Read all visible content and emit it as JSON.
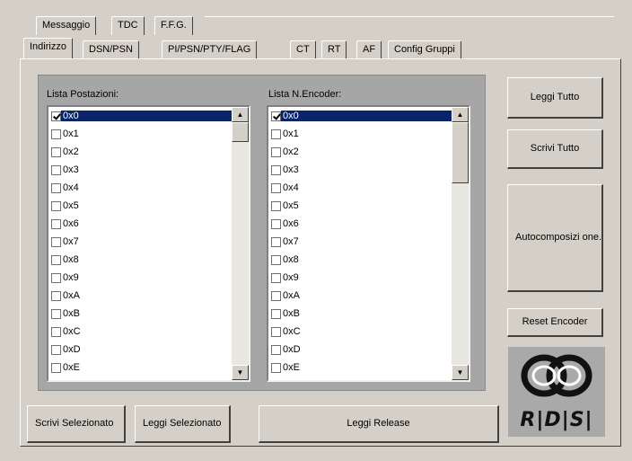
{
  "top_tabs": [
    "Messaggio",
    "TDC",
    "F.F.G."
  ],
  "sub_tabs": [
    "Indirizzo",
    "DSN/PSN",
    "PI/PSN/PTY/FLAG",
    "CT",
    "RT",
    "AF",
    "Config Gruppi"
  ],
  "selected_sub_tab": "Indirizzo",
  "lists": {
    "postazioni": {
      "label": "Lista Postazioni:",
      "items": [
        {
          "label": "0x0",
          "checked": true,
          "selected": true
        },
        {
          "label": "0x1",
          "checked": false,
          "selected": false
        },
        {
          "label": "0x2",
          "checked": false,
          "selected": false
        },
        {
          "label": "0x3",
          "checked": false,
          "selected": false
        },
        {
          "label": "0x4",
          "checked": false,
          "selected": false
        },
        {
          "label": "0x5",
          "checked": false,
          "selected": false
        },
        {
          "label": "0x6",
          "checked": false,
          "selected": false
        },
        {
          "label": "0x7",
          "checked": false,
          "selected": false
        },
        {
          "label": "0x8",
          "checked": false,
          "selected": false
        },
        {
          "label": "0x9",
          "checked": false,
          "selected": false
        },
        {
          "label": "0xA",
          "checked": false,
          "selected": false
        },
        {
          "label": "0xB",
          "checked": false,
          "selected": false
        },
        {
          "label": "0xC",
          "checked": false,
          "selected": false
        },
        {
          "label": "0xD",
          "checked": false,
          "selected": false
        },
        {
          "label": "0xE",
          "checked": false,
          "selected": false
        }
      ]
    },
    "encoder": {
      "label": "Lista N.Encoder:",
      "items": [
        {
          "label": "0x0",
          "checked": true,
          "selected": true
        },
        {
          "label": "0x1",
          "checked": false,
          "selected": false
        },
        {
          "label": "0x2",
          "checked": false,
          "selected": false
        },
        {
          "label": "0x3",
          "checked": false,
          "selected": false
        },
        {
          "label": "0x4",
          "checked": false,
          "selected": false
        },
        {
          "label": "0x5",
          "checked": false,
          "selected": false
        },
        {
          "label": "0x6",
          "checked": false,
          "selected": false
        },
        {
          "label": "0x7",
          "checked": false,
          "selected": false
        },
        {
          "label": "0x8",
          "checked": false,
          "selected": false
        },
        {
          "label": "0x9",
          "checked": false,
          "selected": false
        },
        {
          "label": "0xA",
          "checked": false,
          "selected": false
        },
        {
          "label": "0xB",
          "checked": false,
          "selected": false
        },
        {
          "label": "0xC",
          "checked": false,
          "selected": false
        },
        {
          "label": "0xD",
          "checked": false,
          "selected": false
        },
        {
          "label": "0xE",
          "checked": false,
          "selected": false
        }
      ]
    }
  },
  "buttons": {
    "leggi_tutto": "Leggi Tutto",
    "scrivi_tutto": "Scrivi Tutto",
    "autocomposizione": "Autocomposizi one.",
    "reset_encoder": "Reset Encoder",
    "scrivi_selezionato": "Scrivi Selezionato",
    "leggi_selezionato": "Leggi Selezionato",
    "leggi_release": "Leggi Release"
  },
  "logo": {
    "text": "R|D|S|",
    "icon": "rds-logo-icon"
  },
  "icons": {
    "scroll_up": "scroll-up-arrow-icon",
    "scroll_down": "scroll-down-arrow-icon",
    "checkbox": "checkbox-icon"
  },
  "colors": {
    "selection": "#0a246a",
    "face": "#d4d0c8",
    "group": "#a6a6a6"
  }
}
